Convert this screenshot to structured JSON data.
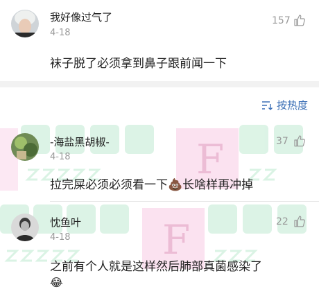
{
  "comments": [
    {
      "username": "我好像过气了",
      "date": "4-18",
      "likes": "157",
      "text": "袜子脱了必须拿到鼻子跟前闻一下",
      "avatar": "avatar-light-hair"
    },
    {
      "username": "-海盐黑胡椒-",
      "date": "4-18",
      "likes": "37",
      "text_before": "拉完屎必须必须看一下",
      "emoji": "💩",
      "text_after": "长啥样再冲掉",
      "avatar": "avatar-green"
    },
    {
      "username": "忱鱼叶",
      "date": "4-18",
      "likes": "22",
      "text": "之前有个人就是这样然后肺部真菌感染了",
      "emoji": "😂",
      "avatar": "avatar-dark-portrait"
    }
  ],
  "sort": {
    "label": "按热度",
    "icon": "sort-icon"
  },
  "colors": {
    "accent": "#3b6fb6",
    "muted": "#999999"
  }
}
